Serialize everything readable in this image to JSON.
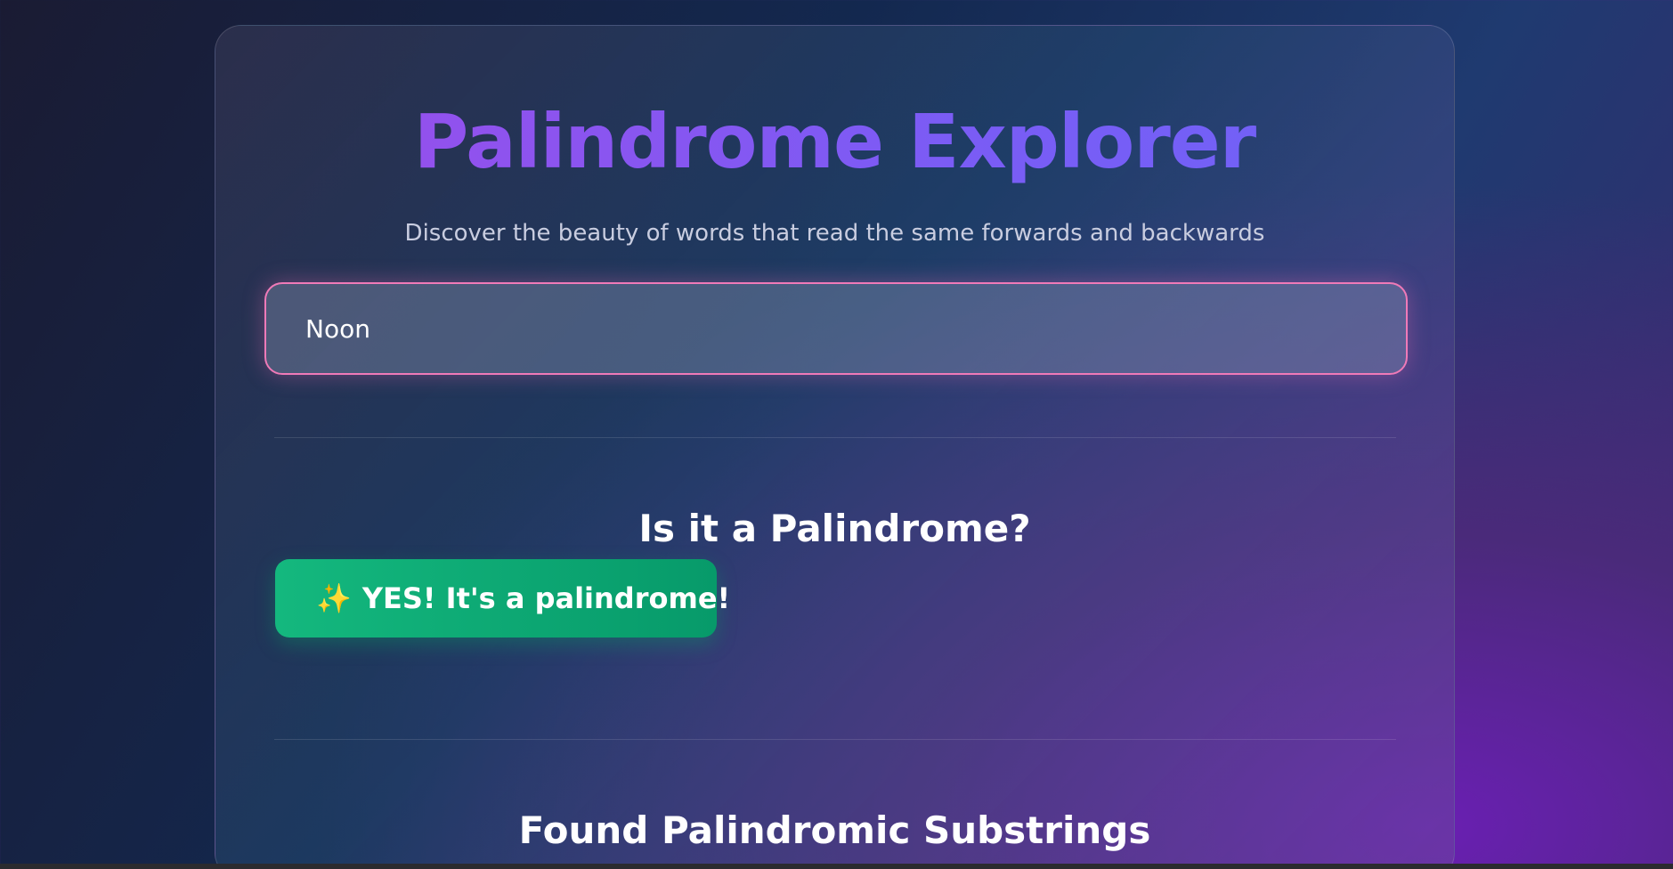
{
  "header": {
    "title": "Palindrome Explorer",
    "subtitle": "Discover the beauty of words that read the same forwards and backwards"
  },
  "input": {
    "value": "Noon"
  },
  "check_section": {
    "title": "Is it a Palindrome?",
    "result_icon": "✨",
    "result_label": "YES! It's a palindrome!"
  },
  "substrings_section": {
    "title": "Found Palindromic Substrings"
  },
  "colors": {
    "title_gradient_start": "#9b4dea",
    "title_gradient_end": "#6e63f7",
    "input_border": "#f07ab8",
    "success": "#10b981"
  }
}
